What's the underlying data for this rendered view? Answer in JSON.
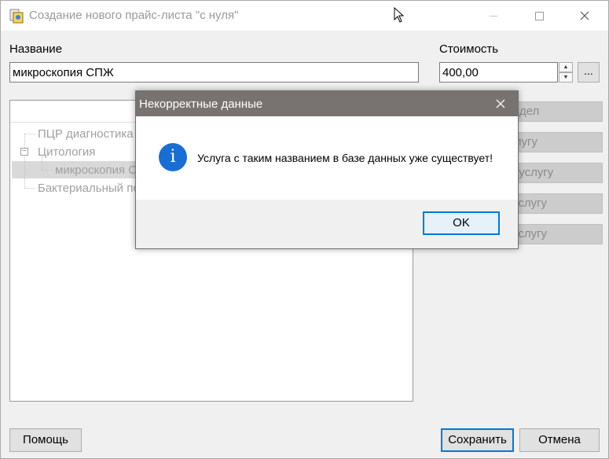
{
  "window": {
    "title": "Создание нового прайс-листа \"с нуля\""
  },
  "form": {
    "name_label": "Название",
    "name_value": "микроскопия СПЖ",
    "cost_label": "Стоимость",
    "cost_value": "400,00",
    "ellipsis_label": "..."
  },
  "tree": {
    "items": [
      {
        "label": "ПЦР диагностика"
      },
      {
        "label": "Цитология"
      },
      {
        "label": "микроскопия С"
      },
      {
        "label": "Бактериальный по"
      }
    ]
  },
  "side_buttons": [
    {
      "label": "ь раздел"
    },
    {
      "label": "ь услугу"
    },
    {
      "label": " раздел/услугу"
    },
    {
      "label": "здел/услугу"
    },
    {
      "label": "здел/услугу"
    }
  ],
  "footer": {
    "help_label": "Помощь",
    "save_label": "Сохранить",
    "cancel_label": "Отмена"
  },
  "dialog": {
    "title": "Некорректные данные",
    "message": "Услуга с таким названием в базе данных уже существует!",
    "ok_label": "OK",
    "icon": "info-icon"
  },
  "colors": {
    "accent": "#0078d7",
    "dialog_titlebar": "#787370",
    "info_icon": "#1a6dd1"
  }
}
